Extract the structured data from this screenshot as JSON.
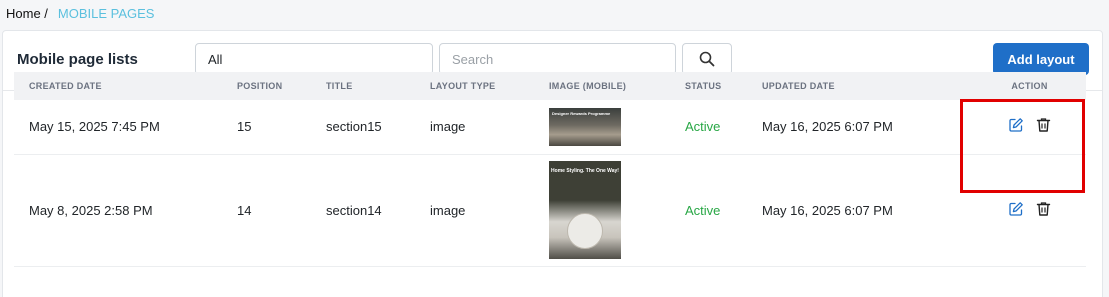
{
  "breadcrumb": {
    "home": "Home /",
    "current": "MOBILE PAGES"
  },
  "header": {
    "title": "Mobile page lists",
    "filter_value": "All",
    "search_placeholder": "Search",
    "add_label": "Add layout"
  },
  "table": {
    "columns": [
      "CREATED DATE",
      "POSITION",
      "TITLE",
      "LAYOUT TYPE",
      "IMAGE (MOBILE)",
      "STATUS",
      "UPDATED DATE",
      "ACTION"
    ],
    "rows": [
      {
        "created": "May 15, 2025 7:45 PM",
        "position": "15",
        "title": "section15",
        "layout": "image",
        "image_text": "Designer Rewards Programme",
        "status": "Active",
        "updated": "May 16, 2025 6:07 PM"
      },
      {
        "created": "May 8, 2025 2:58 PM",
        "position": "14",
        "title": "section14",
        "layout": "image",
        "image_text": "Home Styling. The One Way!",
        "status": "Active",
        "updated": "May 16, 2025 6:07 PM"
      }
    ]
  },
  "colors": {
    "primary": "#1f6fc8",
    "active": "#28a745",
    "breadcrumb_current": "#5bc0de",
    "highlight": "#e10000"
  },
  "icons": [
    "search-icon",
    "edit-icon",
    "trash-icon"
  ]
}
